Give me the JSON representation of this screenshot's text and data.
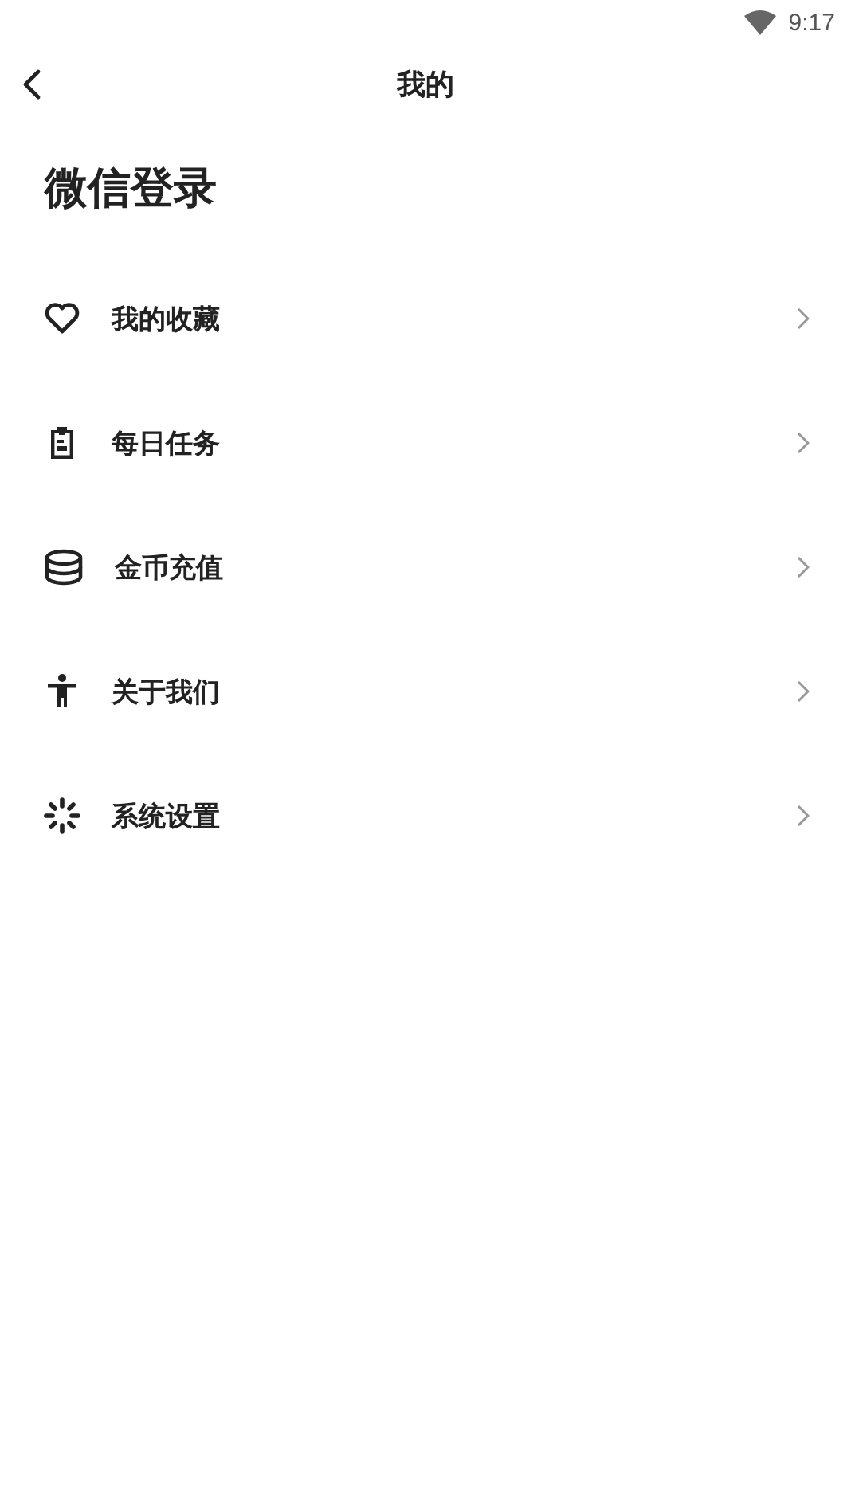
{
  "status_bar": {
    "time": "9:17"
  },
  "header": {
    "title": "我的"
  },
  "login": {
    "label": "微信登录"
  },
  "menu": [
    {
      "kind": "heart",
      "label": "我的收藏"
    },
    {
      "kind": "clipboard",
      "label": "每日任务"
    },
    {
      "kind": "coins",
      "label": "金币充值"
    },
    {
      "kind": "person",
      "label": "关于我们"
    },
    {
      "kind": "spinner",
      "label": "系统设置"
    }
  ]
}
